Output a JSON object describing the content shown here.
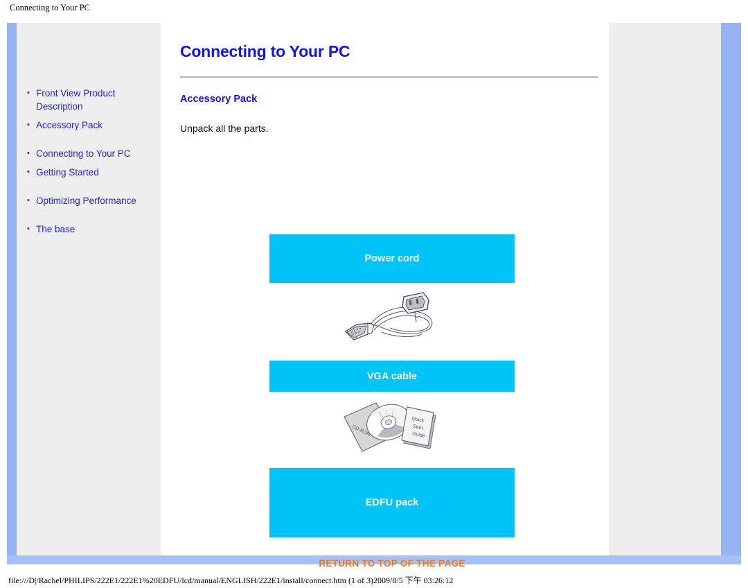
{
  "window": {
    "caption": "Connecting to Your PC"
  },
  "sidebar": {
    "items": [
      {
        "label": "Front View Product Description",
        "gap_before": false
      },
      {
        "label": "Accessory Pack",
        "gap_before": false
      },
      {
        "label": "Connecting to Your PC",
        "gap_before": true
      },
      {
        "label": "Getting Started",
        "gap_before": false
      },
      {
        "label": "Optimizing Performance",
        "gap_before": true
      },
      {
        "label": "The base",
        "gap_before": true
      }
    ]
  },
  "main": {
    "title": "Connecting to Your PC",
    "section_title": "Accessory Pack",
    "intro_text": "Unpack all the parts.",
    "accessories": [
      {
        "label": "Power cord",
        "figure": "power-cable-illustration"
      },
      {
        "label": "VGA cable",
        "figure": "cdrom-quick-start-guide-illustration"
      },
      {
        "label": "EDFU pack",
        "figure": ""
      }
    ],
    "return_link": "RETURN TO TOP OF THE PAGE"
  },
  "figures": {
    "cable_alt": "vga-cable-illustration",
    "cd_alt": "cdrom-and-quick-start-guide-illustration",
    "cd_sleeve_label": "CD-ROM",
    "guide_line1": "Quick",
    "guide_line2": "Start",
    "guide_line3": "Guide"
  },
  "status": {
    "path_text": "file:///D|/Rachel/PHILIPS/222E1/222E1%20EDFU/lcd/manual/ENGLISH/222E1/install/connect.htm (1 of 3)2009/8/5 下午 03:26:12"
  },
  "colors": {
    "link_blue": "#2222ee",
    "heading_blue": "#1414e6",
    "banner_cyan": "#00c4f5",
    "return_orange": "#f07820",
    "rail_blue": "#94b4f4",
    "panel_gray": "#eeeeee"
  }
}
